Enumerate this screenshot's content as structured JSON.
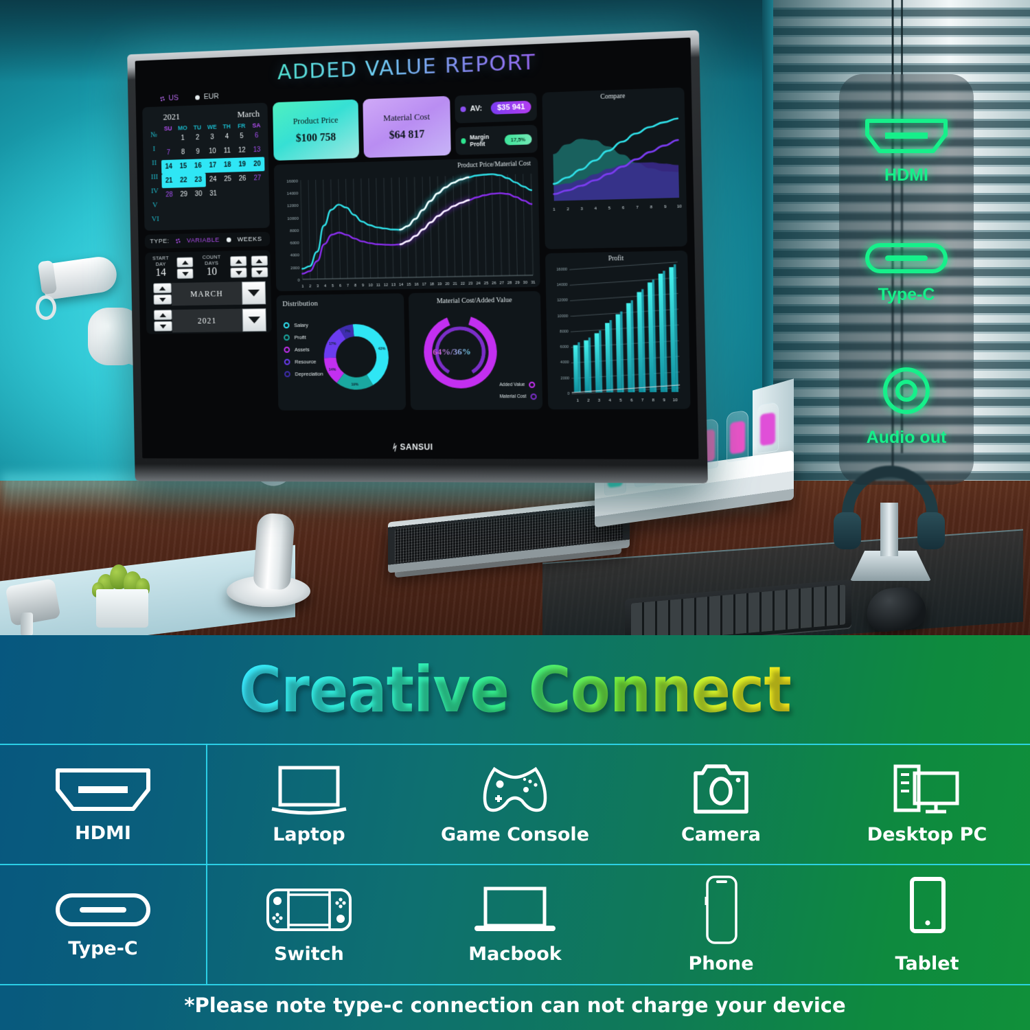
{
  "scene": {
    "monitor_brand": "SANSUI",
    "brand_mark": "ᛋ"
  },
  "dashboard": {
    "title": "ADDED VALUE REPORT",
    "currency": [
      {
        "label": "US",
        "icon": "radio-dotted-icon",
        "selected": true
      },
      {
        "label": "EUR",
        "icon": "radio-filled-icon",
        "selected": false
      }
    ],
    "calendar": {
      "year": "2021",
      "month": "March",
      "week_col_header": "№",
      "week_numbers": [
        "I",
        "II",
        "III",
        "IV",
        "V",
        "VI"
      ],
      "day_headers": [
        "SU",
        "MO",
        "TU",
        "WE",
        "TH",
        "FR",
        "SA"
      ],
      "weeks": [
        [
          "",
          "1",
          "2",
          "3",
          "4",
          "5",
          "6"
        ],
        [
          "7",
          "8",
          "9",
          "10",
          "11",
          "12",
          "13"
        ],
        [
          "14",
          "15",
          "16",
          "17",
          "18",
          "19",
          "20"
        ],
        [
          "21",
          "22",
          "23",
          "24",
          "25",
          "26",
          "27"
        ],
        [
          "28",
          "29",
          "30",
          "31",
          "",
          "",
          ""
        ]
      ],
      "selected_days": [
        14,
        15,
        16,
        17,
        18,
        19,
        20,
        21,
        22,
        23
      ],
      "weekend_days": [
        6,
        7,
        13,
        27,
        28
      ],
      "highlight_color": "#2fe6f5"
    },
    "type_row": {
      "label": "TYPE:",
      "option_variable": "VARIABLE",
      "option_weeks": "WEEKS",
      "selected": "VARIABLE"
    },
    "controls": {
      "start_day_label": "START DAY",
      "start_day_value": "14",
      "count_days_label": "COUNT DAYS",
      "count_days_value": "10",
      "month_select": "MARCH",
      "year_select": "2021"
    },
    "kpis": [
      {
        "title": "Product Price",
        "value": "$100 758",
        "color": "#36e0d4"
      },
      {
        "title": "Material Cost",
        "value": "$64 817",
        "color": "#b98df2"
      }
    ],
    "badges": [
      {
        "label": "AV:",
        "value": "$35 941",
        "dot_color": "#8b4ff0"
      },
      {
        "label": "Margin Profit",
        "value": "17,5%",
        "dot_color": "#2ee58f"
      }
    ]
  },
  "chart_data": [
    {
      "type": "line",
      "title": "Product Price/Material Cost",
      "xlabel": "",
      "ylabel": "",
      "ylim": [
        0,
        16000
      ],
      "yticks": [
        0,
        2000,
        4000,
        6000,
        8000,
        10000,
        12000,
        14000,
        16000
      ],
      "x": [
        1,
        2,
        3,
        4,
        5,
        6,
        7,
        8,
        9,
        10,
        11,
        12,
        13,
        14,
        15,
        16,
        17,
        18,
        19,
        20,
        21,
        22,
        23,
        24,
        25,
        26,
        27,
        28,
        29,
        30,
        31
      ],
      "grid": true,
      "series": [
        {
          "name": "Product Price",
          "color": "#2fe0e8",
          "values": [
            1700,
            2100,
            4400,
            8600,
            11100,
            11900,
            11400,
            10200,
            9100,
            8500,
            8100,
            7900,
            7700,
            7650,
            8200,
            9300,
            10700,
            12100,
            13300,
            14200,
            14900,
            15400,
            15700,
            15950,
            16050,
            16100,
            15900,
            15400,
            14700,
            14000,
            13400
          ]
        },
        {
          "name": "Material Cost",
          "color": "#8b2ef0",
          "values": [
            900,
            1300,
            2900,
            5600,
            7100,
            7400,
            7000,
            6400,
            5900,
            5600,
            5400,
            5300,
            5250,
            5300,
            5800,
            6600,
            7600,
            8700,
            9700,
            10500,
            11200,
            11700,
            12100,
            12500,
            12800,
            13000,
            13050,
            12900,
            12400,
            11800,
            11200
          ]
        }
      ],
      "highlight_range": [
        14,
        23
      ]
    },
    {
      "type": "area",
      "title": "Compare",
      "x": [
        1,
        2,
        3,
        4,
        5,
        6,
        7,
        8,
        9,
        10
      ],
      "ylim": [
        0,
        100
      ],
      "grid": false,
      "series": [
        {
          "name": "series-1-line",
          "color": "#2fe0e8",
          "values": [
            20,
            27,
            36,
            46,
            57,
            67,
            76,
            83,
            88,
            92
          ]
        },
        {
          "name": "series-2-line",
          "color": "#7b3cf0",
          "values": [
            8,
            12,
            17,
            23,
            30,
            38,
            46,
            54,
            61,
            67
          ]
        },
        {
          "name": "series-3-area",
          "color": "#1b6f6b",
          "values": [
            55,
            66,
            72,
            70,
            62,
            52,
            42,
            35,
            31,
            30
          ]
        },
        {
          "name": "series-4-area",
          "color": "#3c2a90",
          "values": [
            18,
            20,
            24,
            30,
            36,
            40,
            42,
            42,
            40,
            38
          ]
        }
      ]
    },
    {
      "type": "bar",
      "title": "Profit",
      "categories": [
        "1",
        "2",
        "3",
        "4",
        "5",
        "6",
        "7",
        "8",
        "9",
        "10"
      ],
      "ylim": [
        0,
        16000
      ],
      "yticks": [
        0,
        2000,
        4000,
        6000,
        8000,
        10000,
        12000,
        14000,
        16000
      ],
      "grid": true,
      "values": [
        6100,
        6700,
        7600,
        8900,
        10000,
        11400,
        12800,
        14000,
        15100,
        15900
      ],
      "color": "#2fe0e8"
    },
    {
      "type": "pie",
      "title": "Distribution",
      "legend_position": "left",
      "labels": [
        "Salary",
        "Profit",
        "Assets",
        "Resource",
        "Depreciation"
      ],
      "values": [
        43,
        19,
        14,
        17,
        7
      ],
      "value_labels": [
        "43%",
        "19%",
        "14%",
        "17%",
        "7%"
      ],
      "colors": [
        "#2fe6f5",
        "#1aa8a0",
        "#c32ff0",
        "#6b3cf0",
        "#3f2db0"
      ]
    },
    {
      "type": "pie",
      "title": "Material Cost/Added Value",
      "center_label": "64%/36%",
      "labels": [
        "Added Value",
        "Material Cost"
      ],
      "values": [
        64,
        36
      ],
      "colors": [
        "#c32ff0",
        "#7b2ec8"
      ]
    }
  ],
  "ports_callout": [
    {
      "label": "HDMI",
      "icon": "hdmi-port-icon"
    },
    {
      "label": "Type-C",
      "icon": "type-c-port-icon"
    },
    {
      "label": "Audio out",
      "icon": "audio-jack-icon"
    }
  ],
  "bottom": {
    "headline": "Creative Connect",
    "row1": [
      {
        "label": "HDMI",
        "icon": "hdmi-port-icon"
      },
      {
        "label": "Laptop",
        "icon": "laptop-icon"
      },
      {
        "label": "Game Console",
        "icon": "gamepad-icon"
      },
      {
        "label": "Camera",
        "icon": "camera-icon"
      },
      {
        "label": "Desktop PC",
        "icon": "desktop-pc-icon"
      }
    ],
    "row2": [
      {
        "label": "Type-C",
        "icon": "type-c-port-icon"
      },
      {
        "label": "Switch",
        "icon": "switch-console-icon"
      },
      {
        "label": "Macbook",
        "icon": "macbook-icon"
      },
      {
        "label": "Phone",
        "icon": "phone-icon"
      },
      {
        "label": "Tablet",
        "icon": "tablet-icon"
      }
    ],
    "note": "*Please note type-c connection can not charge your device",
    "accent": "#2fd8ef"
  }
}
